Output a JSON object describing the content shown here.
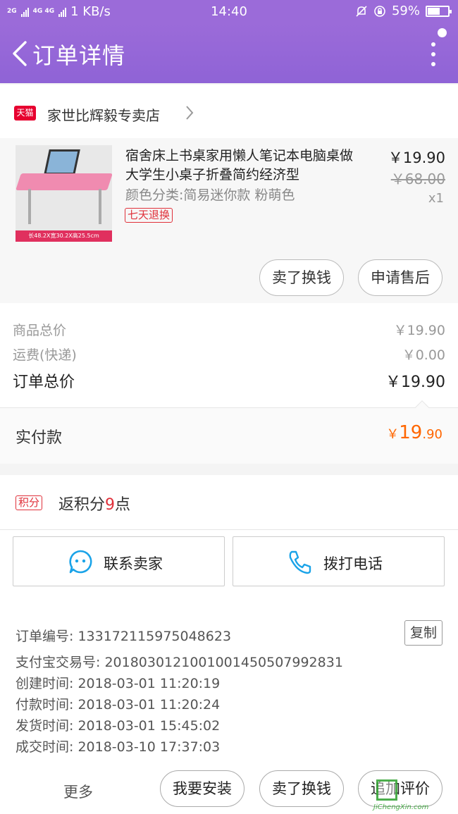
{
  "status_bar": {
    "network_1": "2G",
    "network_2": "4G 4G",
    "speed": "1 KB/s",
    "time": "14:40",
    "battery": "59%",
    "battery_level": 0.59
  },
  "header": {
    "title": "订单详情"
  },
  "shop": {
    "tmall_label": "天猫",
    "name": "家世比辉毅专卖店"
  },
  "item": {
    "title": "宿舍床上书桌家用懒人笔记本电脑桌做大学生小桌子折叠简约经济型",
    "spec": "颜色分类:简易迷你款 粉萌色",
    "return_badge": "七天退换",
    "price": "￥19.90",
    "original_price": "￥68.00",
    "quantity": "x1",
    "image_caption": "长48.2X宽30.2X高25.5cm",
    "sell_button": "卖了换钱",
    "after_sale_button": "申请售后"
  },
  "summary": {
    "goods_label": "商品总价",
    "goods_value": "￥19.90",
    "shipping_label": "运费(快递)",
    "shipping_value": "￥0.00",
    "total_label": "订单总价",
    "total_value": "￥19.90"
  },
  "paid": {
    "label": "实付款",
    "currency": "￥",
    "integer": "19",
    "decimal": ".90"
  },
  "points": {
    "badge": "积分",
    "text_prefix": "返积分",
    "count": "9",
    "text_suffix": "点"
  },
  "contact": {
    "seller_label": "联系卖家",
    "phone_label": "拨打电话"
  },
  "order_info": {
    "order_no": "订单编号: 1331721159750486​23",
    "alipay_no": "支付宝交易号: 2018030121001001450507992831",
    "created": "创建时间: 2018-03-01 11:20:19",
    "paid": "付款时间: 2018-03-01 11:20:24",
    "shipped": "发货时间: 2018-03-01 15:45:02",
    "completed": "成交时间: 2018-03-10 17:37:03",
    "copy_label": "复制"
  },
  "bottom_bar": {
    "more": "更多",
    "install": "我要安装",
    "sell": "卖了换钱",
    "review": "追加评价"
  },
  "watermark": {
    "text": "JiChengXin.com"
  },
  "colors": {
    "header": "#9b6bd9",
    "accent_red": "#e0303a",
    "paid_orange": "#ff6600",
    "contact_blue": "#1aa3e8"
  }
}
